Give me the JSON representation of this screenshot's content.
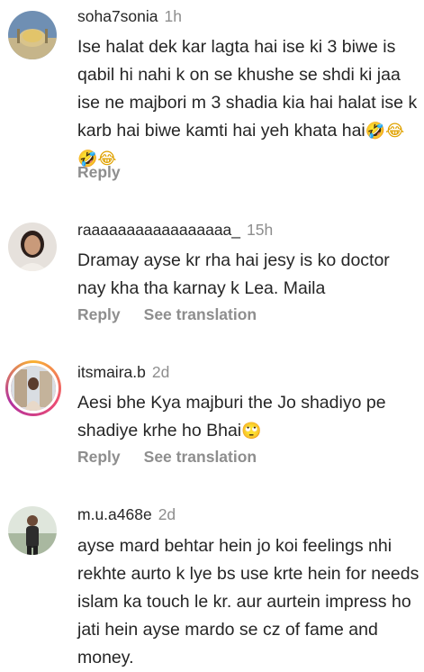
{
  "comments": [
    {
      "username": "soha7sonia",
      "time": "1h",
      "text": "Ise halat dek kar lagta hai ise ki 3 biwe is qabil hi nahi k on se khushe se shdi ki jaa ise ne majbori m 3 shadia kia hai halat ise k karb hai biwe kamti hai yeh khata hai",
      "emoji": "🤣😂🤣😂",
      "reply_label": "Reply",
      "translate_label": ""
    },
    {
      "username": "raaaaaaaaaaaaaaaaa_",
      "time": "15h",
      "text": "Dramay ayse kr rha hai jesy is ko doctor nay kha tha karnay k Lea. Maila",
      "emoji": "",
      "reply_label": "Reply",
      "translate_label": "See translation"
    },
    {
      "username": "itsmaira.b",
      "time": "2d",
      "text": "Aesi bhe Kya majburi the Jo shadiyo pe shadiye krhe ho Bhai",
      "emoji": "🙄",
      "reply_label": "Reply",
      "translate_label": "See translation"
    },
    {
      "username": "m.u.a468e",
      "time": "2d",
      "text": "ayse mard behtar hein jo koi feelings nhi rekhte aurto k lye bs use krte hein for needs islam ka touch le kr. aur aurtein impress ho jati hein ayse mardo se cz of fame and money.",
      "emoji": "",
      "reply_label": "",
      "translate_label": ""
    }
  ]
}
